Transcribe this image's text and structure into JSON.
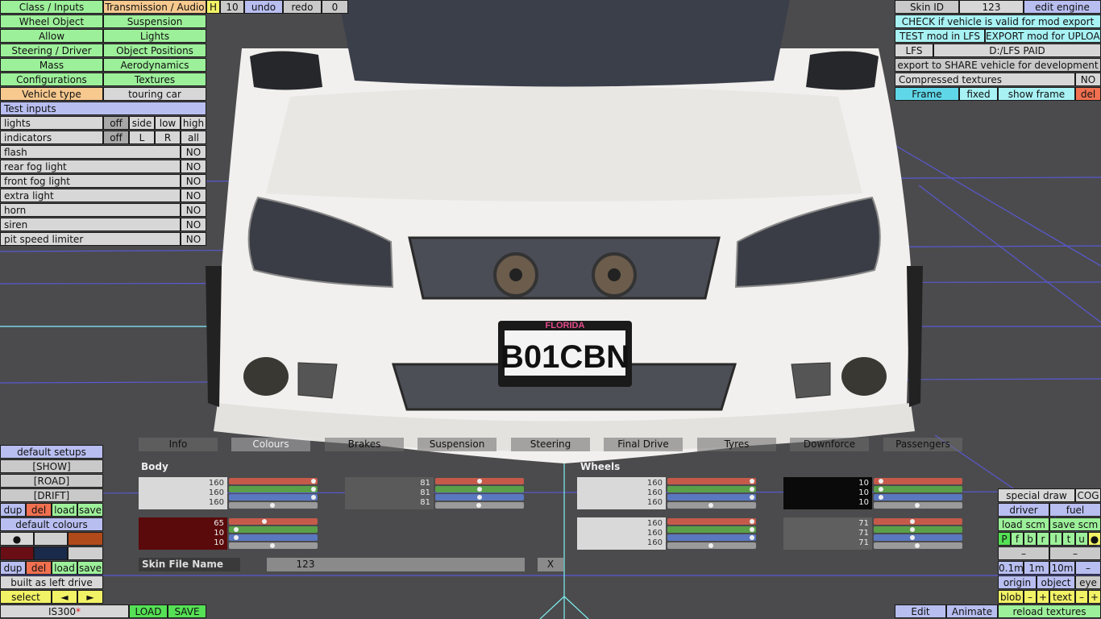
{
  "left_menu": {
    "class_inputs": "Class / Inputs",
    "transmission_audio": "Transmission / Audio",
    "h_label": "H",
    "h_value": "10",
    "undo": "undo",
    "redo": "redo",
    "redo_count": "0",
    "wheel_object": "Wheel Object",
    "suspension": "Suspension",
    "allow": "Allow",
    "lights": "Lights",
    "steering_driver": "Steering / Driver",
    "object_positions": "Object Positions",
    "mass": "Mass",
    "aerodynamics": "Aerodynamics",
    "configurations": "Configurations",
    "textures": "Textures",
    "vehicle_type_label": "Vehicle type",
    "vehicle_type_value": "touring car"
  },
  "test_inputs": {
    "title": "Test inputs",
    "lights_label": "lights",
    "lights_opts": [
      "off",
      "side",
      "low",
      "high"
    ],
    "indicators_label": "indicators",
    "indicators_opts": [
      "off",
      "L",
      "R",
      "all"
    ],
    "rows": [
      {
        "label": "flash",
        "value": "NO"
      },
      {
        "label": "rear fog light",
        "value": "NO"
      },
      {
        "label": "front fog light",
        "value": "NO"
      },
      {
        "label": "extra light",
        "value": "NO"
      },
      {
        "label": "horn",
        "value": "NO"
      },
      {
        "label": "siren",
        "value": "NO"
      },
      {
        "label": "pit speed limiter",
        "value": "NO"
      }
    ]
  },
  "right_panel": {
    "skin_id_label": "Skin ID",
    "skin_id_value": "123",
    "edit_engine": "edit engine",
    "check_valid": "CHECK if vehicle is valid for mod export",
    "test_mod": "TEST mod in LFS",
    "export_mod": "EXPORT mod for UPLOAD",
    "lfs_label": "LFS",
    "lfs_path": "D:/LFS PAID",
    "export_share": "export to SHARE vehicle for development",
    "compressed_label": "Compressed textures",
    "compressed_value": "NO",
    "frame_label": "Frame",
    "frame_value": "fixed",
    "show_frame": "show frame",
    "del": "del"
  },
  "plate_text": "B01CBN",
  "plate_state": "FLORIDA",
  "tabs": [
    "Info",
    "Colours",
    "Brakes",
    "Suspension",
    "Steering",
    "Final Drive",
    "Tyres",
    "Downforce",
    "Passengers"
  ],
  "colours": {
    "body_title": "Body",
    "wheels_title": "Wheels",
    "swatches": [
      {
        "values": [
          "160",
          "160",
          "160"
        ],
        "color": "#d9d9d9",
        "text": "#333"
      },
      {
        "values": [
          "81",
          "81",
          "81"
        ],
        "color": "#5a5a5a",
        "text": "#eee"
      },
      {
        "values": [
          "65",
          "10",
          "10"
        ],
        "color": "#5a0a0a",
        "text": "#eee"
      },
      {
        "values": [
          "160",
          "160",
          "160"
        ],
        "color": "#d9d9d9",
        "text": "#333"
      },
      {
        "values": [
          "10",
          "10",
          "10"
        ],
        "color": "#0a0a0a",
        "text": "#eee"
      },
      {
        "values": [
          "160",
          "160",
          "160"
        ],
        "color": "#d9d9d9",
        "text": "#333"
      },
      {
        "values": [
          "71",
          "71",
          "71"
        ],
        "color": "#5f5f5f",
        "text": "#eee"
      }
    ],
    "skin_file_label": "Skin File Name",
    "skin_file_value": "123",
    "x_button": "X"
  },
  "bottom_left": {
    "default_setups": "default setups",
    "show": "[SHOW]",
    "road": "[ROAD]",
    "drift": "[DRIFT]",
    "dup": "dup",
    "del": "del",
    "load": "load",
    "save": "save",
    "default_colours": "default colours",
    "dot": "●",
    "built_as": "built as left drive",
    "select": "select",
    "prev": "◄",
    "next": "►",
    "car_name": "IS300",
    "car_mark": "*",
    "load_btn": "LOAD",
    "save_btn": "SAVE"
  },
  "bottom_right": {
    "special_draw": "special draw",
    "cog": "COG",
    "driver": "driver",
    "fuel": "fuel",
    "load_scm": "load scm",
    "save_scm": "save scm",
    "letters": [
      "P",
      "f",
      "b",
      "r",
      "l",
      "t",
      "u",
      "●"
    ],
    "minus": "–",
    "zoom": [
      "0.1m",
      "1m",
      "10m",
      "–"
    ],
    "origin": "origin",
    "object": "object",
    "eye": "eye",
    "blob": "blob",
    "text": "text",
    "plus": "+",
    "reload_textures": "reload textures",
    "edit": "Edit",
    "animate": "Animate"
  }
}
